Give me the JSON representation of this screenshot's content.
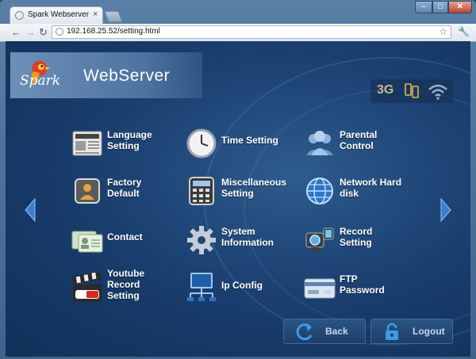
{
  "browser": {
    "tab_title": "Spark Webserver",
    "tab_close": "×",
    "url": "192.168.25.52/setting.html",
    "window_controls": {
      "minimize": "–",
      "maximize": "□",
      "close": "✕"
    }
  },
  "header": {
    "logo_script": "Spark",
    "logo_word": "WebServer"
  },
  "status": {
    "network": "3G"
  },
  "menu": [
    {
      "label": "Language Setting",
      "icon": "news-icon"
    },
    {
      "label": "Time Setting",
      "icon": "clock-icon"
    },
    {
      "label": "Parental Control",
      "icon": "people-icon"
    },
    {
      "label": "Factory Default",
      "icon": "factory-icon"
    },
    {
      "label": "Miscellaneous Setting",
      "icon": "calculator-icon"
    },
    {
      "label": "Network Hard disk",
      "icon": "globe-icon"
    },
    {
      "label": "Contact",
      "icon": "contact-card-icon"
    },
    {
      "label": "System Information",
      "icon": "gear-icon"
    },
    {
      "label": "Record Setting",
      "icon": "camcorder-icon"
    },
    {
      "label": "Youtube Record Setting",
      "icon": "youtube-clapper-icon"
    },
    {
      "label": "Ip Config",
      "icon": "network-monitor-icon"
    },
    {
      "label": "FTP Password",
      "icon": "card-icon"
    }
  ],
  "buttons": {
    "back": "Back",
    "logout": "Logout"
  },
  "colors": {
    "background": "#1f4677",
    "accent": "#3a7fd0",
    "text": "#ffffff"
  }
}
